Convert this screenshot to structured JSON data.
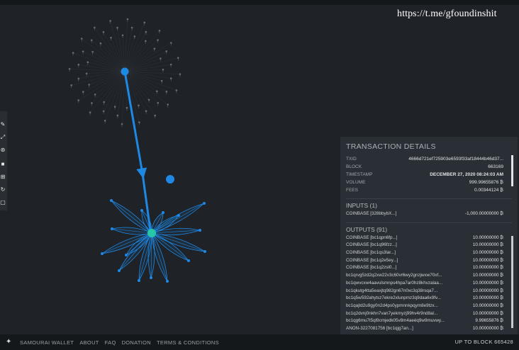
{
  "watermark": "https://t.me/gfoundinshit",
  "panel": {
    "title": "TRANSACTION DETAILS",
    "details": [
      {
        "key": "TXID",
        "value": "4666d721ef725903e6593f33af18444b46d37..."
      },
      {
        "key": "BLOCK",
        "value": "663169"
      },
      {
        "key": "TIMESTAMP",
        "value": "DECEMBER 27, 2020 08:24:03 AM"
      },
      {
        "key": "VOLUME",
        "value": "999.99655876 ₿"
      },
      {
        "key": "FEES",
        "value": "0.00344124 ₿"
      }
    ],
    "inputs_header": "INPUTS (1)",
    "inputs": [
      {
        "addr": "COINBASE [328bbybX...]",
        "amount": "-1,000.00000000 ₿"
      }
    ],
    "outputs_header": "OUTPUTS (91)",
    "outputs": [
      {
        "addr": "COINBASE [bc1qpn6fp...]",
        "amount": "10.00000000 ₿"
      },
      {
        "addr": "COINBASE [bc1q96fzz...]",
        "amount": "10.00000000 ₿"
      },
      {
        "addr": "COINBASE [bc1qs3lar...]",
        "amount": "10.00000000 ₿"
      },
      {
        "addr": "COINBASE [bc1q2e5ey...]",
        "amount": "10.00000000 ₿"
      },
      {
        "addr": "COINBASE [bc1q2zsl0...]",
        "amount": "10.00000000 ₿"
      },
      {
        "addr": "bc1qrvg5zd2q2xw22v3c60vr6wy2gnzjwxw70xf...",
        "amount": "10.00000000 ₿"
      },
      {
        "addr": "bc1qwvcxw4aavulsmnps4hpa7ar0hz8khvzalaa...",
        "amount": "10.00000000 ₿"
      },
      {
        "addr": "bc1qkutg4tta5eaxjtq982gn67n0xc3q38rsqa7...",
        "amount": "10.00000000 ₿"
      },
      {
        "addr": "bc1q5w592ahytsz7ekre2xlunpmz3q9daa6x9fv...",
        "amount": "10.00000000 ₿"
      },
      {
        "addr": "bc1qajtd2u9gy0n2d4ps0ypmnnkpqym8e9tzx...",
        "amount": "10.00000000 ₿"
      },
      {
        "addr": "bc1q2dvnj0nkhn7van7yekmyzj99hv4r9nd8al...",
        "amount": "10.00000000 ₿"
      },
      {
        "addr": "bc1qg6mu7t5ql9cmjedk05v8m4aeéq9w9muvwy...",
        "amount": "9.99655876 ₿"
      },
      {
        "addr": "ANON-3227081756 [bc1qjg7an...]",
        "amount": "10.00000000 ₿"
      }
    ]
  },
  "footer": {
    "links": [
      "SAMOURAI WALLET",
      "ABOUT",
      "FAQ",
      "DONATION",
      "TERMS & CONDITIONS"
    ],
    "block_status": "UP TO BLOCK 665428"
  },
  "toolbar": {
    "tools": [
      "pencil-icon",
      "link-icon",
      "pin-icon",
      "square-icon",
      "grid-icon",
      "refresh-icon",
      "frame-icon"
    ]
  },
  "colors": {
    "background": "#1f2226",
    "node_blue": "#1e88e5",
    "node_teal": "#26c6a6",
    "panel_bg": "#2a2f35"
  }
}
